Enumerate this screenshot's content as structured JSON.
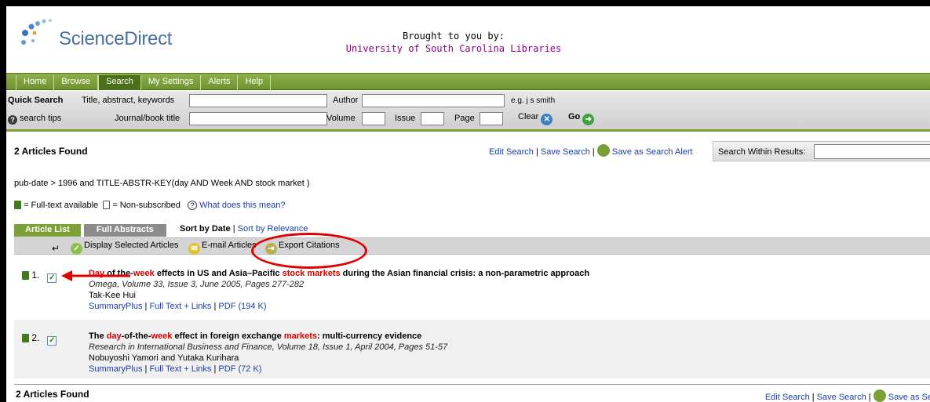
{
  "brand": {
    "name": "ScienceDirect",
    "brought_line1": "Brought to you by:",
    "brought_line2": "University of South Carolina Libraries"
  },
  "nav": {
    "tabs": [
      "Home",
      "Browse",
      "Search",
      "My Settings",
      "Alerts",
      "Help"
    ],
    "active": "Search"
  },
  "quick_search": {
    "label": "Quick Search",
    "title_label": "Title, abstract, keywords",
    "title_value": "",
    "author_label": "Author",
    "author_value": "",
    "example": "e.g. j s smith",
    "tips": "search tips",
    "journal_label": "Journal/book title",
    "journal_value": "",
    "volume_label": "Volume",
    "issue_label": "Issue",
    "page_label": "Page",
    "clear_label": "Clear",
    "go_label": "Go"
  },
  "results": {
    "count_text": "2 Articles Found",
    "edit_search": "Edit Search",
    "save_search": "Save Search",
    "save_alert": "Save as Search Alert",
    "save_alert_truncated": "Save as Se",
    "search_within_label": "Search Within Results:",
    "search_within_value": "",
    "query": "pub-date > 1996 and TITLE-ABSTR-KEY(day AND Week AND stock market )",
    "legend_full": "= Full-text available",
    "legend_non": "= Non-subscribed",
    "legend_help": "What does this mean?",
    "tab_article_list": "Article List",
    "tab_full_abstracts": "Full Abstracts",
    "sort_by_date": "Sort by Date",
    "sort_by_relevance": "Sort by Relevance",
    "action_display": "Display Selected Articles",
    "action_email": "E-mail Articles",
    "action_export": "Export Citations"
  },
  "articles": [
    {
      "num": "1.",
      "checked": true,
      "title_parts": [
        {
          "t": "Day",
          "hl": true
        },
        {
          "t": " of the-",
          "hl": false
        },
        {
          "t": "week",
          "hl": true
        },
        {
          "t": " effects in US and Asia–Pacific ",
          "hl": false
        },
        {
          "t": "stock markets",
          "hl": true
        },
        {
          "t": " during the Asian financial crisis: a non-parametric approach",
          "hl": false
        }
      ],
      "source": "Omega, Volume 33, Issue 3, June 2005, Pages 277-282",
      "authors": "Tak-Kee Hui",
      "links": [
        "SummaryPlus",
        "Full Text + Links",
        "PDF (194 K)"
      ]
    },
    {
      "num": "2.",
      "checked": true,
      "title_parts": [
        {
          "t": "The ",
          "hl": false
        },
        {
          "t": "day",
          "hl": true
        },
        {
          "t": "-of-the-",
          "hl": false
        },
        {
          "t": "week",
          "hl": true
        },
        {
          "t": " effect in foreign exchange ",
          "hl": false
        },
        {
          "t": "markets",
          "hl": true
        },
        {
          "t": ": multi-currency evidence",
          "hl": false
        }
      ],
      "source": "Research in International Business and Finance, Volume 18, Issue 1, April 2004, Pages 51-57",
      "authors": "Nobuyoshi Yamori and Yutaka Kurihara",
      "links": [
        "SummaryPlus",
        "Full Text + Links",
        "PDF (72 K)"
      ]
    }
  ],
  "colors": {
    "nav_green": "#7aa036",
    "link_blue": "#1a3ea8",
    "highlight_red": "#d40000",
    "annotation_red": "#e00000"
  },
  "icons": [
    "sciencedirect-logo-icon",
    "help-icon",
    "clear-x-icon",
    "go-arrow-icon",
    "save-alert-icon",
    "question-icon",
    "check-icon",
    "email-icon",
    "export-icon",
    "full-text-icon"
  ]
}
